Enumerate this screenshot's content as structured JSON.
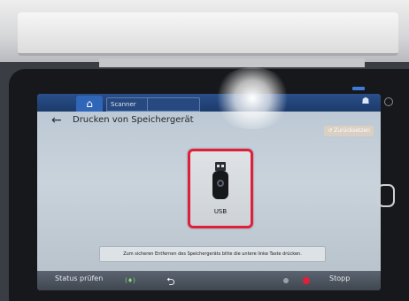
{
  "tabs": {
    "scanner": "Scanner",
    "other": ""
  },
  "header": {
    "title": "Drucken von Speichergerät",
    "reset": "Zurücksetzen"
  },
  "device_tile": {
    "label": "USB",
    "icon": "usb-drive-icon",
    "highlight_color": "#e0203a"
  },
  "notice": "Zum sicheren Entfernen des Speichergeräts bitte die untere linke Taste drücken.",
  "bottom_bar": {
    "status": "Status prüfen",
    "stop": "Stopp"
  },
  "colors": {
    "tab_bar": "#1d3b6b",
    "screen_bg": "#c9d3dc",
    "stop": "#e0203a"
  }
}
